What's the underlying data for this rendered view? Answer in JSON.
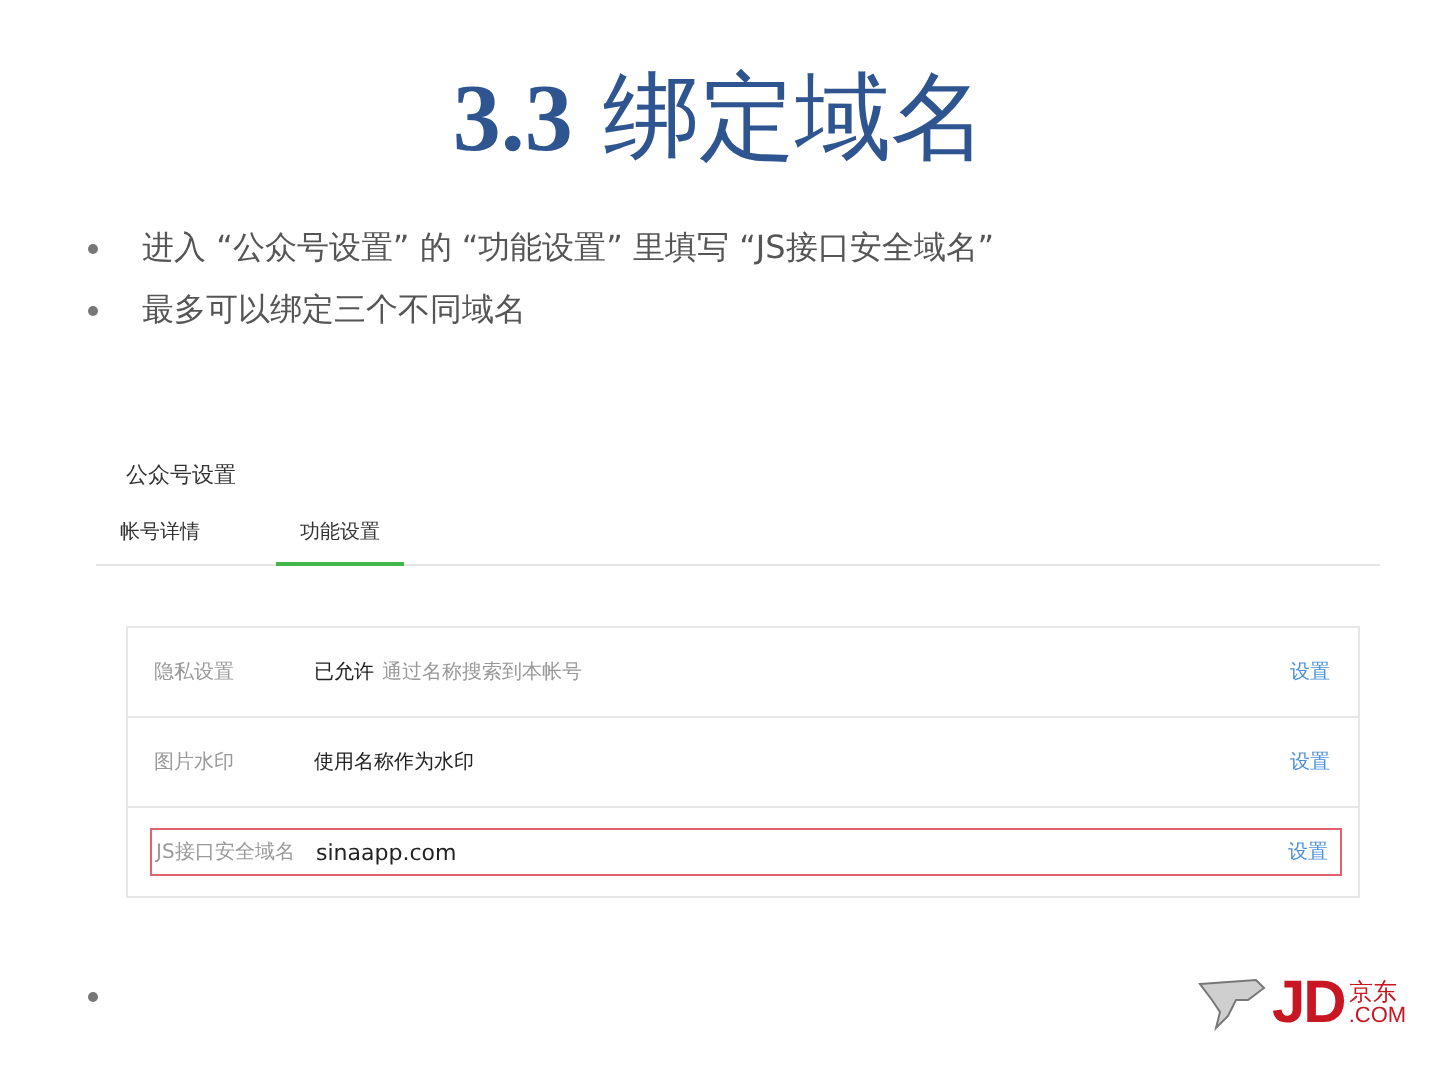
{
  "slide": {
    "title_number": "3.3",
    "title_text": "绑定域名",
    "bullets": [
      {
        "kind": "text",
        "text": "进入 “公众号设置” 的 “功能设置” 里填写 “JS接口安全域名”"
      },
      {
        "kind": "text",
        "text": "最多可以绑定三个不同域名"
      },
      {
        "kind": "empty"
      }
    ]
  },
  "screen": {
    "heading": "公众号设置",
    "tabs": [
      {
        "label": "帐号详情",
        "selected": false
      },
      {
        "label": "功能设置",
        "selected": true
      }
    ],
    "rows": [
      {
        "label": "隐私设置",
        "value": "已允许",
        "note": "通过名称搜索到本帐号",
        "action": "设置",
        "highlighted": false
      },
      {
        "label": "图片水印",
        "value": "使用名称作为水印",
        "action": "设置",
        "highlighted": false
      },
      {
        "label": "JS接口安全域名",
        "value": "sinaapp.com",
        "action": "设置",
        "highlighted": true
      }
    ]
  },
  "logo": {
    "letters": "JD",
    "cn": "京东",
    "domain": ".COM"
  }
}
